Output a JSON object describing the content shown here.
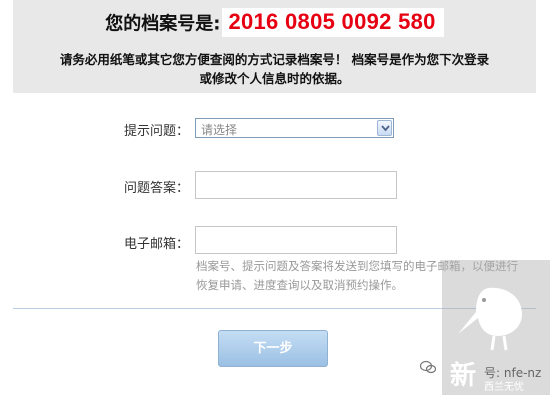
{
  "banner": {
    "archive_label": "您的档案号是:",
    "archive_number": "2016 0805 0092 580",
    "notice_line1": "请务必用纸笔或其它您方便查阅的方式记录档案号！ 档案号是作为您下次登录",
    "notice_line2": "或修改个人信息时的依据。"
  },
  "form": {
    "question_label": "提示问题：",
    "question_select_value": "请选择",
    "answer_label": "问题答案：",
    "answer_value": "",
    "email_label": "电子邮箱：",
    "email_value": "",
    "help_line1": "档案号、提示问题及答案将发送到您填写的电子邮箱，以便进行",
    "help_line2": "恢复申请、进度查询以及取消预约操作。"
  },
  "actions": {
    "next_label": "下一步"
  },
  "watermark": {
    "text": "号: nfe-nz",
    "big": "新",
    "small": "西兰无忧"
  }
}
